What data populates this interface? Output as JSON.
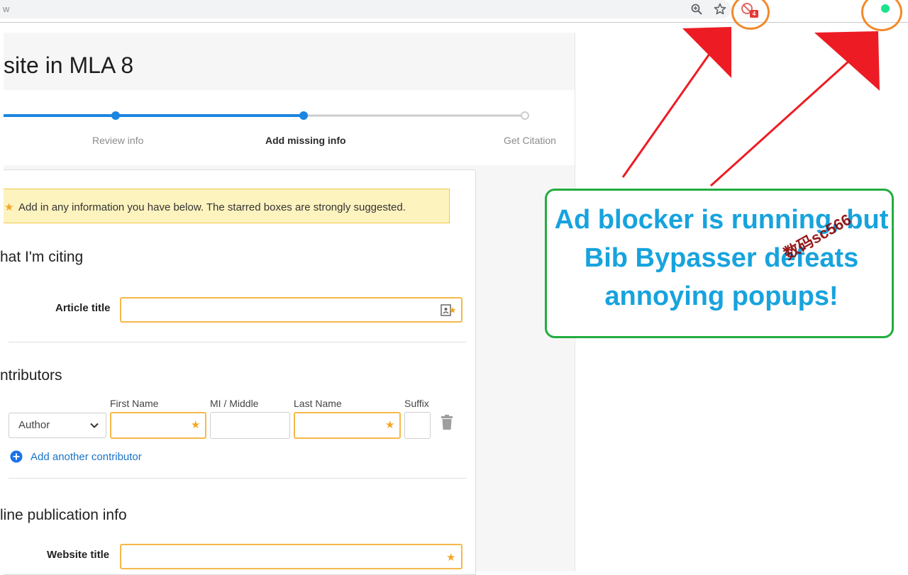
{
  "browser": {
    "address_fragment": "w",
    "extension_badge": "4"
  },
  "page": {
    "title": "site in MLA 8",
    "steps": [
      "Review info",
      "Add missing info",
      "Get Citation"
    ],
    "active_step": "Add missing info",
    "notice": "Add in any information you have below. The starred boxes are strongly suggested.",
    "sections": {
      "citing": "hat I'm citing",
      "contributors": "ntributors",
      "publication": "line publication info"
    },
    "fields": {
      "article_title_label": "Article title",
      "website_title_label": "Website title"
    },
    "contributor_columns": [
      "First Name",
      "MI / Middle",
      "Last Name",
      "Suffix"
    ],
    "contributor_role": "Author",
    "add_contributor": "Add another contributor"
  },
  "annotation": {
    "callout_lines": [
      "Ad blocker is running, but",
      "Bib Bypasser defeats",
      "annoying popups!"
    ],
    "watermark": "数码sc566"
  },
  "colors": {
    "accent_blue": "#1a73c7",
    "required_orange": "#f6b84a",
    "callout_green": "#21ad3f",
    "callout_text": "#17a3dd",
    "arrow_red": "#ed1c24",
    "ring_orange": "#f28a2c"
  },
  "icons": [
    "zoom-icon",
    "bookmark-star-icon",
    "extension-icon",
    "status-dot-icon",
    "chevron-down-icon",
    "trash-icon",
    "plus-circle-icon",
    "autofill-icon"
  ]
}
